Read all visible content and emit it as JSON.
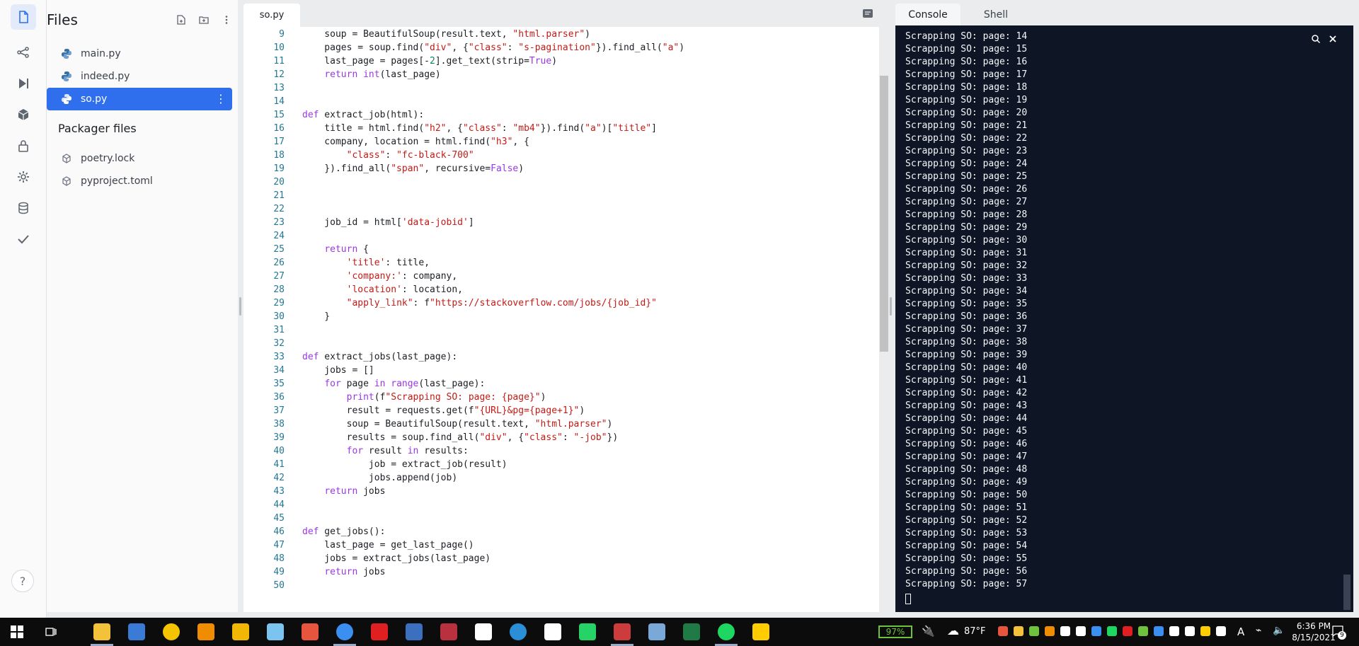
{
  "rail": {
    "items": [
      "files-icon",
      "git-icon",
      "debugger-icon",
      "packages-icon",
      "secrets-icon",
      "settings-icon",
      "database-icon",
      "unit-tests-icon"
    ],
    "help_label": "?"
  },
  "files": {
    "title": "Files",
    "items": [
      {
        "name": "main.py",
        "icon": "python-icon"
      },
      {
        "name": "indeed.py",
        "icon": "python-icon"
      },
      {
        "name": "so.py",
        "icon": "python-icon",
        "active": true
      }
    ],
    "packager_title": "Packager files",
    "packager_items": [
      {
        "name": "poetry.lock",
        "icon": "package-icon"
      },
      {
        "name": "pyproject.toml",
        "icon": "package-icon"
      }
    ]
  },
  "editor": {
    "tab_label": "so.py",
    "lines": [
      {
        "n": "9",
        "code": "    soup = BeautifulSoup(result.text, \"html.parser\")"
      },
      {
        "n": "10",
        "code": "    pages = soup.find(\"div\", {\"class\": \"s-pagination\"}).find_all(\"a\")"
      },
      {
        "n": "11",
        "code": "    last_page = pages[-2].get_text(strip=True)"
      },
      {
        "n": "12",
        "code": "    return int(last_page)"
      },
      {
        "n": "13",
        "code": ""
      },
      {
        "n": "14",
        "code": ""
      },
      {
        "n": "15",
        "code": "def extract_job(html):"
      },
      {
        "n": "16",
        "code": "    title = html.find(\"h2\", {\"class\": \"mb4\"}).find(\"a\")[\"title\"]"
      },
      {
        "n": "17",
        "code": "    company, location = html.find(\"h3\", {"
      },
      {
        "n": "18",
        "code": "        \"class\": \"fc-black-700\""
      },
      {
        "n": "19",
        "code": "    }).find_all(\"span\", recursive=False)"
      },
      {
        "n": "20",
        "code": ""
      },
      {
        "n": "21",
        "code": ""
      },
      {
        "n": "22",
        "code": ""
      },
      {
        "n": "23",
        "code": "    job_id = html['data-jobid']"
      },
      {
        "n": "24",
        "code": ""
      },
      {
        "n": "25",
        "code": "    return {"
      },
      {
        "n": "26",
        "code": "        'title': title,"
      },
      {
        "n": "27",
        "code": "        'company:': company,"
      },
      {
        "n": "28",
        "code": "        'location': location,"
      },
      {
        "n": "29",
        "code": "        \"apply_link\": f\"https://stackoverflow.com/jobs/{job_id}\""
      },
      {
        "n": "30",
        "code": "    }"
      },
      {
        "n": "31",
        "code": ""
      },
      {
        "n": "32",
        "code": ""
      },
      {
        "n": "33",
        "code": "def extract_jobs(last_page):"
      },
      {
        "n": "34",
        "code": "    jobs = []"
      },
      {
        "n": "35",
        "code": "    for page in range(last_page):"
      },
      {
        "n": "36",
        "code": "        print(f\"Scrapping SO: page: {page}\")"
      },
      {
        "n": "37",
        "code": "        result = requests.get(f\"{URL}&pg={page+1}\")"
      },
      {
        "n": "38",
        "code": "        soup = BeautifulSoup(result.text, \"html.parser\")"
      },
      {
        "n": "39",
        "code": "        results = soup.find_all(\"div\", {\"class\": \"-job\"})"
      },
      {
        "n": "40",
        "code": "        for result in results:"
      },
      {
        "n": "41",
        "code": "            job = extract_job(result)"
      },
      {
        "n": "42",
        "code": "            jobs.append(job)"
      },
      {
        "n": "43",
        "code": "    return jobs"
      },
      {
        "n": "44",
        "code": ""
      },
      {
        "n": "45",
        "code": ""
      },
      {
        "n": "46",
        "code": "def get_jobs():"
      },
      {
        "n": "47",
        "code": "    last_page = get_last_page()"
      },
      {
        "n": "48",
        "code": "    jobs = extract_jobs(last_page)"
      },
      {
        "n": "49",
        "code": "    return jobs"
      },
      {
        "n": "50",
        "code": ""
      }
    ]
  },
  "console": {
    "tabs": [
      "Console",
      "Shell"
    ],
    "active_tab": "Console",
    "lines": [
      "Scrapping SO: page: 14",
      "Scrapping SO: page: 15",
      "Scrapping SO: page: 16",
      "Scrapping SO: page: 17",
      "Scrapping SO: page: 18",
      "Scrapping SO: page: 19",
      "Scrapping SO: page: 20",
      "Scrapping SO: page: 21",
      "Scrapping SO: page: 22",
      "Scrapping SO: page: 23",
      "Scrapping SO: page: 24",
      "Scrapping SO: page: 25",
      "Scrapping SO: page: 26",
      "Scrapping SO: page: 27",
      "Scrapping SO: page: 28",
      "Scrapping SO: page: 29",
      "Scrapping SO: page: 30",
      "Scrapping SO: page: 31",
      "Scrapping SO: page: 32",
      "Scrapping SO: page: 33",
      "Scrapping SO: page: 34",
      "Scrapping SO: page: 35",
      "Scrapping SO: page: 36",
      "Scrapping SO: page: 37",
      "Scrapping SO: page: 38",
      "Scrapping SO: page: 39",
      "Scrapping SO: page: 40",
      "Scrapping SO: page: 41",
      "Scrapping SO: page: 42",
      "Scrapping SO: page: 43",
      "Scrapping SO: page: 44",
      "Scrapping SO: page: 45",
      "Scrapping SO: page: 46",
      "Scrapping SO: page: 47",
      "Scrapping SO: page: 48",
      "Scrapping SO: page: 49",
      "Scrapping SO: page: 50",
      "Scrapping SO: page: 51",
      "Scrapping SO: page: 52",
      "Scrapping SO: page: 53",
      "Scrapping SO: page: 54",
      "Scrapping SO: page: 55",
      "Scrapping SO: page: 56",
      "Scrapping SO: page: 57"
    ]
  },
  "taskbar": {
    "apps": [
      "file-explorer-icon",
      "calculator-icon",
      "media-player-icon",
      "search-tool-icon",
      "puzzle-app-icon",
      "clipboard-app-icon",
      "git-client-icon",
      "chrome-icon",
      "lightning-app-icon",
      "globe-app-icon",
      "media-app-icon",
      "timer-app-icon",
      "edge-icon",
      "dict-app-icon",
      "whatsapp-icon",
      "pen-app-icon",
      "notepad-icon",
      "excel-icon",
      "spotify-icon",
      "kakaotalk-icon"
    ],
    "battery": "97%",
    "temperature": "87°F",
    "ime": "A",
    "time": "6:36 PM",
    "date": "8/15/2021",
    "notifications": "9"
  },
  "colors": {
    "accent": "#2f6fed",
    "console_bg": "#0e1525",
    "keyword": "#9b37e3",
    "string": "#c41a16"
  }
}
